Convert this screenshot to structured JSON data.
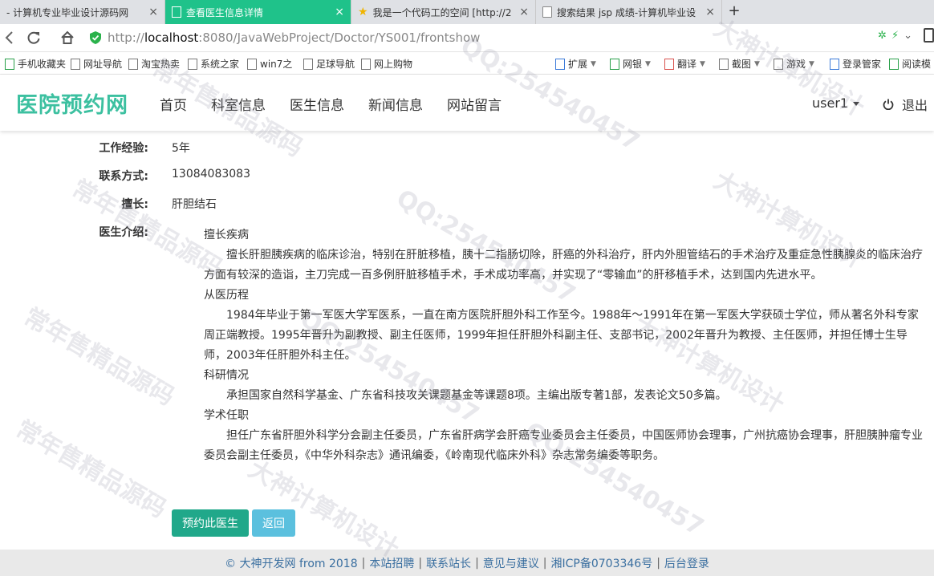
{
  "browser": {
    "tabs": [
      {
        "title": "- 计算机专业毕业设计源码网",
        "active": false
      },
      {
        "title": "查看医生信息详情",
        "active": true
      },
      {
        "title": "我是一个代码工的空间 [http://2",
        "active": false
      },
      {
        "title": "搜索结果 jsp 成绩-计算机毕业设",
        "active": false
      }
    ],
    "new_tab_symbol": "+",
    "close_symbol": "×",
    "url": {
      "proto": "http://",
      "host": "localhost",
      "path": ":8080/JavaWebProject/Doctor/YS001/frontshow"
    },
    "bookmarks": [
      {
        "label": "手机收藏夹",
        "icon": "bookmark-icon"
      },
      {
        "label": "网址导航",
        "icon": "page-icon"
      },
      {
        "label": "淘宝热卖",
        "icon": "page-icon"
      },
      {
        "label": "系统之家",
        "icon": "page-icon"
      },
      {
        "label": "win7之",
        "icon": "page-icon"
      },
      {
        "label": "足球导航",
        "icon": "page-icon"
      },
      {
        "label": "网上购物",
        "icon": "page-icon"
      },
      {
        "label": "扩展",
        "icon": "grid-icon"
      },
      {
        "label": "网银",
        "icon": "shield-icon"
      },
      {
        "label": "翻译",
        "icon": "translate-icon"
      },
      {
        "label": "截图",
        "icon": "scissors-icon"
      },
      {
        "label": "游戏",
        "icon": "gamepad-icon"
      },
      {
        "label": "登录管家",
        "icon": "key-icon"
      },
      {
        "label": "阅读模",
        "icon": "book-icon"
      }
    ]
  },
  "site": {
    "logo": "医院预约网",
    "nav": [
      "首页",
      "科室信息",
      "医生信息",
      "新闻信息",
      "网站留言"
    ],
    "user": "user1",
    "logout": "退出"
  },
  "doctor": {
    "experience_label": "工作经验:",
    "experience": "5年",
    "contact_label": "联系方式:",
    "contact": "13084083083",
    "specialty_label": "擅长:",
    "specialty": "肝胆结石",
    "intro_label": "医生介绍:",
    "intro": [
      {
        "heading": "擅长疾病",
        "text": "擅长肝胆胰疾病的临床诊治，特别在肝脏移植，胰十二指肠切除，肝癌的外科治疗，肝内外胆管结石的手术治疗及重症急性胰腺炎的临床治疗方面有较深的造诣，主刀完成一百多例肝脏移植手术，手术成功率高，并实现了“零输血”的肝移植手术，达到国内先进水平。"
      },
      {
        "heading": "从医历程",
        "text": "1984年毕业于第一军医大学军医系，一直在南方医院肝胆外科工作至今。1988年～1991年在第一军医大学获硕士学位，师从著名外科专家周正端教授。1995年晋升为副教授、副主任医师，1999年担任肝胆外科副主任、支部书记，2002年晋升为教授、主任医师，并担任博士生导师，2003年任肝胆外科主任。"
      },
      {
        "heading": "科研情况",
        "text": "承担国家自然科学基金、广东省科技攻关课题基金等课题8项。主编出版专著1部，发表论文50多篇。"
      },
      {
        "heading": "学术任职",
        "text": "担任广东省肝胆外科学分会副主任委员，广东省肝病学会肝癌专业委员会主任委员，中国医师协会理事，广州抗癌协会理事，肝胆胰肿瘤专业委员会副主任委员，《中华外科杂志》通讯编委，《岭南现代临床外科》杂志常务编委等职务。"
      }
    ],
    "book_button": "预约此医生",
    "back_button": "返回"
  },
  "footer": {
    "copyright": "© 大神开发网 from 2018",
    "links": [
      "本站招聘",
      "联系站长",
      "意见与建议",
      "湘ICP备0703346号",
      "后台登录"
    ]
  },
  "watermarks": [
    "常年售精品源码",
    "QQ:254540457",
    "大神计算机设计",
    "常年售精品源码",
    "QQ:254540457",
    "大神计算机设计",
    "常年售精品源码",
    "QQ:254540457",
    "大神计算机设计",
    "常年售精品源码",
    "QQ:254540457",
    "大神计算机设计"
  ]
}
